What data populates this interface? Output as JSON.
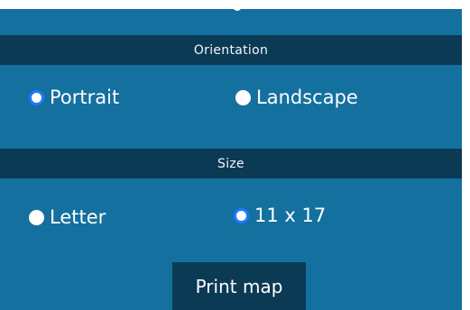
{
  "colors": {
    "panel_background": "#14709f",
    "header_background": "#0b3a55",
    "button_background": "#0b3a55",
    "radio_selected_ring": "#1f78ff",
    "text": "#ffffff"
  },
  "orientation": {
    "header": "Orientation",
    "selected": "portrait",
    "options": [
      {
        "id": "portrait",
        "label": "Portrait",
        "checked": true
      },
      {
        "id": "landscape",
        "label": "Landscape",
        "checked": false
      }
    ]
  },
  "size": {
    "header": "Size",
    "selected": "11x17",
    "options": [
      {
        "id": "letter",
        "label": "Letter",
        "checked": false
      },
      {
        "id": "11x17",
        "label": "11 x 17",
        "checked": true
      }
    ]
  },
  "actions": {
    "print_label": "Print map"
  }
}
